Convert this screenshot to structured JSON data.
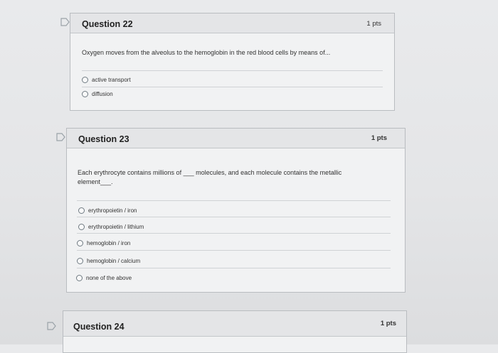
{
  "questions": [
    {
      "title": "Question 22",
      "points": "1 pts",
      "prompt": "Oxygen moves from the alveolus to the hemoglobin in the red blood cells by means of...",
      "options": [
        "active transport",
        "diffusion"
      ]
    },
    {
      "title": "Question 23",
      "points": "1 pts",
      "prompt_line1": "Each erythrocyte contains millions of ___ molecules, and each molecule contains the metallic",
      "prompt_line2": "element___.",
      "options": [
        "erythropoietin / iron",
        "erythropoietin / lithium",
        "hemoglobin / iron",
        "hemoglobin / calcium",
        "none of the above"
      ]
    },
    {
      "title": "Question 24",
      "points": "1 pts"
    }
  ]
}
